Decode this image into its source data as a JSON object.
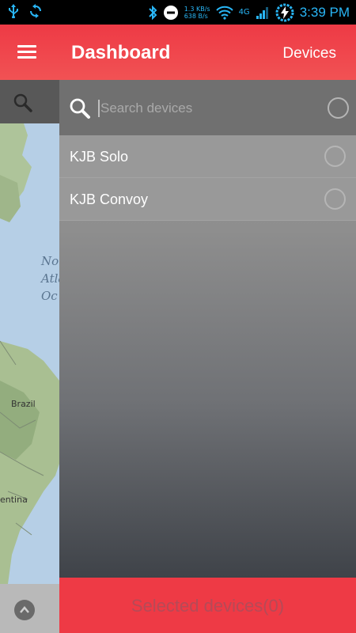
{
  "status_bar": {
    "net_up": "1.3 KB/s",
    "net_down": "638 B/s",
    "network_type": "4G",
    "time": "3:39 PM"
  },
  "app_bar": {
    "title": "Dashboard",
    "action_label": "Devices"
  },
  "map": {
    "ocean_label": [
      "No",
      "Atla",
      "Oc"
    ],
    "country_labels": [
      "Brazil",
      "entina"
    ]
  },
  "drawer": {
    "search_placeholder": "Search devices",
    "search_value": "",
    "devices": [
      {
        "name": "KJB Solo",
        "selected": false
      },
      {
        "name": "KJB Convoy",
        "selected": false
      }
    ]
  },
  "bottom_button": {
    "label": "Selected devices(0)"
  },
  "colors": {
    "accent": "#ee3a45",
    "status_icon": "#29b6f6"
  },
  "icons": [
    "usb-icon",
    "sync-icon",
    "bluetooth-icon",
    "do-not-disturb-icon",
    "wifi-icon",
    "signal-icon",
    "battery-charging-icon",
    "menu-icon",
    "search-icon",
    "chevron-up-icon"
  ]
}
